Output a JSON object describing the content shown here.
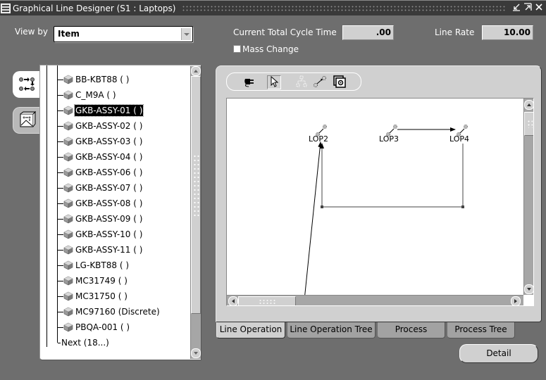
{
  "window": {
    "title": "Graphical Line Designer (S1 : Laptops)",
    "buttons": [
      "minimize-icon",
      "maximize-icon",
      "close-icon"
    ]
  },
  "header": {
    "view_by_label": "View by",
    "view_by_value": "Item",
    "cycle_time_label": "Current Total Cycle Time",
    "cycle_time_value": ".00",
    "line_rate_label": "Line Rate",
    "line_rate_value": "10.00",
    "mass_change_label": "Mass Change",
    "mass_change_checked": false
  },
  "side_tabs": [
    {
      "name": "flow-view-tab",
      "icon": "flow-arrows-icon",
      "active": true
    },
    {
      "name": "diagram-view-tab",
      "icon": "diagram-icon",
      "active": false
    }
  ],
  "tree": {
    "items": [
      {
        "label": "BB-KBT88 ( )",
        "selected": false
      },
      {
        "label": "C_M9A ( )",
        "selected": false
      },
      {
        "label": "GKB-ASSY-01 ( )",
        "selected": true
      },
      {
        "label": "GKB-ASSY-02 ( )",
        "selected": false
      },
      {
        "label": "GKB-ASSY-03 ( )",
        "selected": false
      },
      {
        "label": "GKB-ASSY-04 ( )",
        "selected": false
      },
      {
        "label": "GKB-ASSY-06 ( )",
        "selected": false
      },
      {
        "label": "GKB-ASSY-07 ( )",
        "selected": false
      },
      {
        "label": "GKB-ASSY-08 ( )",
        "selected": false
      },
      {
        "label": "GKB-ASSY-09 ( )",
        "selected": false
      },
      {
        "label": "GKB-ASSY-10 ( )",
        "selected": false
      },
      {
        "label": "GKB-ASSY-11 ( )",
        "selected": false
      },
      {
        "label": "LG-KBT88 ( )",
        "selected": false
      },
      {
        "label": "MC31749 ( )",
        "selected": false
      },
      {
        "label": "MC31750 ( )",
        "selected": false
      },
      {
        "label": "MC97160 (Discrete)",
        "selected": false
      },
      {
        "label": "PBQA-001 ( )",
        "selected": false
      }
    ],
    "next_label": "Next (18...)"
  },
  "toolbar": {
    "tools": [
      {
        "name": "connect-tool",
        "icon": "plug-icon",
        "pressed": false
      },
      {
        "name": "select-tool",
        "icon": "pointer-icon",
        "pressed": true
      },
      {
        "name": "layout-tool",
        "icon": "hierarchy-icon",
        "pressed": false,
        "disabled": true
      },
      {
        "name": "link-tool",
        "icon": "link-nodes-icon",
        "pressed": false
      },
      {
        "name": "properties-tool",
        "icon": "gear-frame-icon",
        "pressed": false
      }
    ]
  },
  "diagram": {
    "nodes": [
      {
        "id": "LOP2",
        "label": "LOP2"
      },
      {
        "id": "LOP3",
        "label": "LOP3"
      },
      {
        "id": "LOP4",
        "label": "LOP4"
      }
    ],
    "edges": [
      {
        "from": "LOP3",
        "to": "LOP4"
      },
      {
        "from": "LOP4",
        "to": "LOP2",
        "routed": true
      },
      {
        "from": "offscreen",
        "to": "LOP2"
      }
    ]
  },
  "tabs": [
    {
      "label": "Line Operation",
      "active": true
    },
    {
      "label": "Line Operation Tree",
      "active": false
    },
    {
      "label": "Process",
      "active": false
    },
    {
      "label": "Process Tree",
      "active": false
    }
  ],
  "actions": {
    "detail_label": "Detail"
  }
}
